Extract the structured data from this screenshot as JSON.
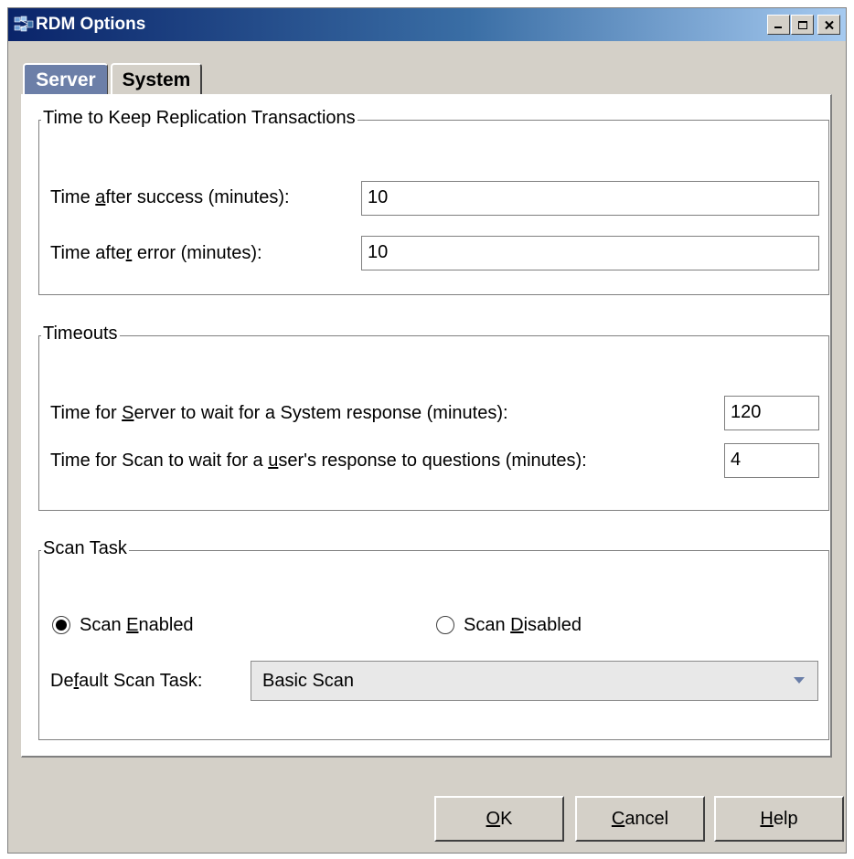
{
  "window": {
    "title": "RDM Options"
  },
  "title_buttons": [
    "minimize",
    "maximize",
    "close"
  ],
  "tabs": [
    {
      "label": "Server",
      "active": true
    },
    {
      "label": "System",
      "active": false
    }
  ],
  "groups": {
    "replication": {
      "title": "Time to Keep Replication Transactions",
      "success_label": {
        "pre": "Time ",
        "key": "a",
        "post": "fter success (minutes):"
      },
      "success_value": "10",
      "error_label": {
        "pre": "Time afte",
        "key": "r",
        "post": " error (minutes):"
      },
      "error_value": "10"
    },
    "timeouts": {
      "title": "Timeouts",
      "server_label": {
        "pre": "Time for ",
        "key": "S",
        "post": "erver to wait for a System response (minutes):"
      },
      "server_value": "120",
      "scan_label": {
        "pre": "Time for Scan to wait for a ",
        "key": "u",
        "post": "ser's response to questions (minutes):"
      },
      "scan_value": "4"
    },
    "scan_task": {
      "title": "Scan Task",
      "enabled_label": {
        "pre": "Scan ",
        "key": "E",
        "post": "nabled"
      },
      "enabled_checked": true,
      "disabled_label": {
        "pre": "Scan ",
        "key": "D",
        "post": "isabled"
      },
      "disabled_checked": false,
      "default_label": {
        "pre": "De",
        "key": "f",
        "post": "ault Scan Task:"
      },
      "default_value": "Basic Scan"
    }
  },
  "buttons": {
    "ok": {
      "pre": "",
      "key": "O",
      "post": "K"
    },
    "cancel": {
      "pre": "",
      "key": "C",
      "post": "ancel"
    },
    "help": {
      "pre": "",
      "key": "H",
      "post": "elp"
    }
  },
  "colors": {
    "titlebar_start": "#0a246a",
    "titlebar_end": "#a6caf0",
    "active_tab": "#6c7fa8",
    "dialog_face": "#d4d0c8"
  }
}
